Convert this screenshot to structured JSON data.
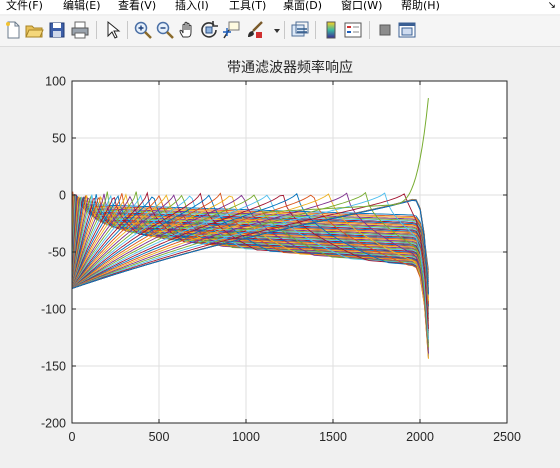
{
  "menu": {
    "file": "文件(F)",
    "edit": "编辑(E)",
    "view": "查看(V)",
    "insert": "插入(I)",
    "tools": "工具(T)",
    "desktop": "桌面(D)",
    "window": "窗口(W)",
    "help": "帮助(H)",
    "more": "↘"
  },
  "toolbar": {
    "icons": [
      "new-figure-icon",
      "open-file-icon",
      "save-icon",
      "print-icon",
      "select-arrow-icon",
      "zoom-in-icon",
      "zoom-out-icon",
      "pan-hand-icon",
      "rotate-3d-icon",
      "data-cursor-icon",
      "brush-icon",
      "brush-dropdown-icon",
      "link-plot-icon",
      "colorbar-icon",
      "legend-icon",
      "hide-plot-tools-icon",
      "show-plot-tools-icon"
    ]
  },
  "chart_data": {
    "type": "line",
    "title": "带通滤波器频率响应",
    "xlabel": "",
    "ylabel": "",
    "xlim": [
      0,
      2500
    ],
    "ylim": [
      -200,
      100
    ],
    "xticks": [
      0,
      500,
      1000,
      1500,
      2000,
      2500
    ],
    "yticks": [
      100,
      50,
      0,
      -50,
      -100,
      -150,
      -200
    ],
    "grid": true,
    "legend": "none",
    "x_range_of_curves": [
      0,
      2048
    ],
    "series_count": 64,
    "series_description": "64 band-pass filter magnitude responses (dB) plotted against frequency bin",
    "series_peaks_x": [
      0,
      4,
      8,
      12,
      16,
      20,
      24,
      28,
      32,
      37,
      42,
      48,
      54,
      61,
      68,
      76,
      85,
      94,
      104,
      115,
      127,
      140,
      154,
      169,
      185,
      203,
      222,
      242,
      264,
      288,
      313,
      340,
      369,
      400,
      434,
      470,
      508,
      549,
      592,
      639,
      688,
      741,
      797,
      856,
      920,
      987,
      1058,
      1134,
      1214,
      1299,
      1389,
      1484,
      1584,
      1690,
      1802,
      1920,
      2040
    ],
    "peak_level_db": 3,
    "lower_envelope_db_at_1000": -65,
    "end_drop_x": 2048,
    "end_min_db": -155,
    "rising_curve": {
      "start_x": 1700,
      "end_x": 2048,
      "end_db": 70
    },
    "colors": [
      "#0072bd",
      "#d95319",
      "#edb120",
      "#7e2f8e",
      "#77ac30",
      "#4dbeee",
      "#a2142f"
    ]
  }
}
